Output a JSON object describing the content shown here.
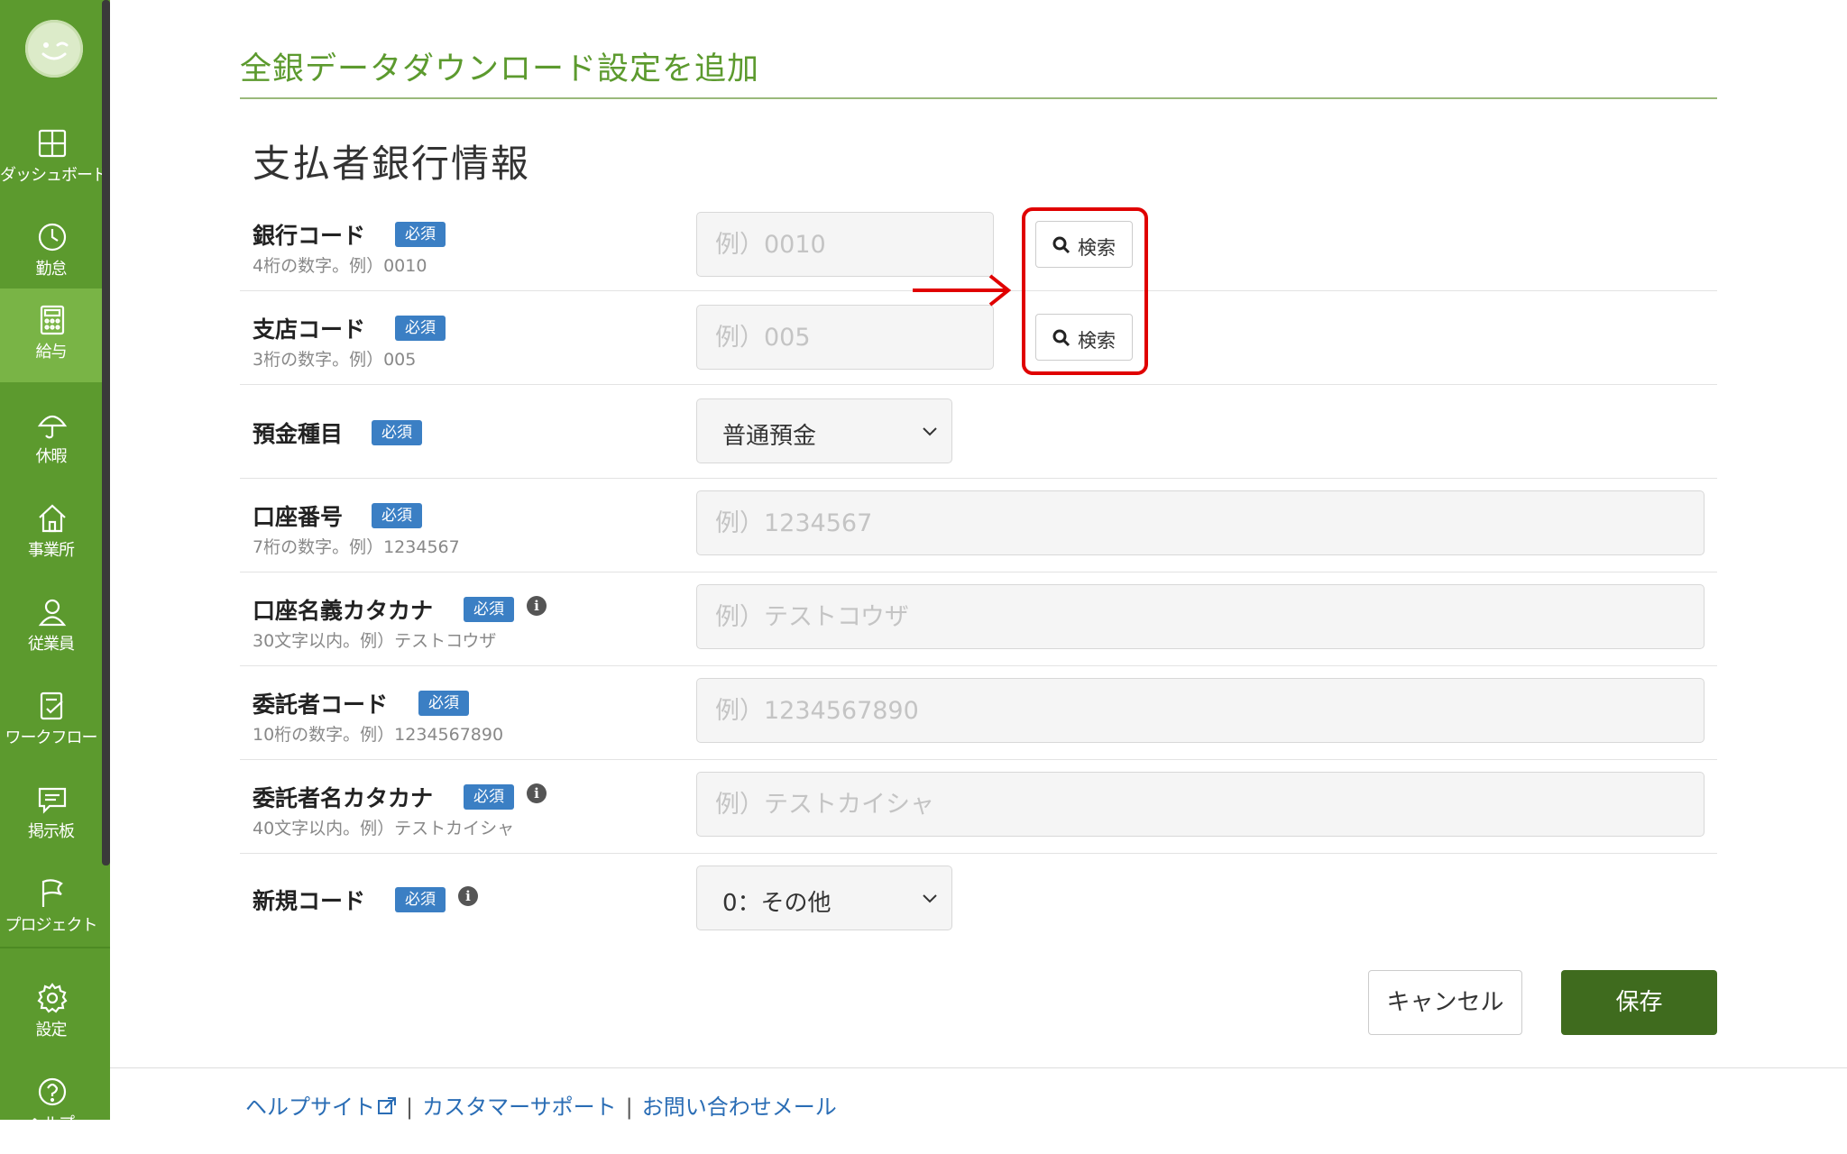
{
  "sidebar": {
    "items": [
      {
        "label": "ダッシュボード",
        "icon": "dashboard-icon"
      },
      {
        "label": "勤怠",
        "icon": "clock-icon"
      },
      {
        "label": "給与",
        "icon": "calculator-icon",
        "active": true
      },
      {
        "label": "休暇",
        "icon": "umbrella-icon"
      },
      {
        "label": "事業所",
        "icon": "home-icon"
      },
      {
        "label": "従業員",
        "icon": "person-icon"
      },
      {
        "label": "ワークフロー",
        "icon": "checklist-icon"
      },
      {
        "label": "掲示板",
        "icon": "chat-icon"
      },
      {
        "label": "プロジェクト",
        "icon": "flag-icon"
      }
    ],
    "bottom": [
      {
        "label": "設定",
        "icon": "gear-icon"
      },
      {
        "label": "ヘルプ",
        "icon": "help-icon"
      }
    ]
  },
  "page": {
    "title": "全銀データダウンロード設定を追加",
    "section_title": "支払者銀行情報"
  },
  "required_label": "必須",
  "search_label": "検索",
  "fields": {
    "bank_code": {
      "label": "銀行コード",
      "hint": "4桁の数字。例）0010",
      "placeholder": "例）0010",
      "value": ""
    },
    "branch_code": {
      "label": "支店コード",
      "hint": "3桁の数字。例）005",
      "placeholder": "例）005",
      "value": ""
    },
    "deposit_type": {
      "label": "預金種目",
      "value": "普通預金"
    },
    "account_number": {
      "label": "口座番号",
      "hint": "7桁の数字。例）1234567",
      "placeholder": "例）1234567",
      "value": ""
    },
    "account_name": {
      "label": "口座名義カタカナ",
      "hint": "30文字以内。例）テストコウザ",
      "placeholder": "例）テストコウザ",
      "value": ""
    },
    "consignor_code": {
      "label": "委託者コード",
      "hint": "10桁の数字。例）1234567890",
      "placeholder": "例）1234567890",
      "value": ""
    },
    "consignor_name": {
      "label": "委託者名カタカナ",
      "hint": "40文字以内。例）テストカイシャ",
      "placeholder": "例）テストカイシャ",
      "value": ""
    },
    "new_code": {
      "label": "新規コード",
      "value": "0：その他"
    }
  },
  "actions": {
    "cancel": "キャンセル",
    "save": "保存"
  },
  "footer": {
    "help_site": "ヘルプサイト",
    "customer_support": "カスタマーサポート",
    "contact_mail": "お問い合わせメール",
    "separator": "|"
  },
  "colors": {
    "brand_green": "#5c9a2e",
    "active_green": "#79b446",
    "save_button": "#3f6b1e",
    "badge_blue": "#3b7fc4",
    "annotation_red": "#e00000",
    "link_blue": "#2a6db5"
  }
}
